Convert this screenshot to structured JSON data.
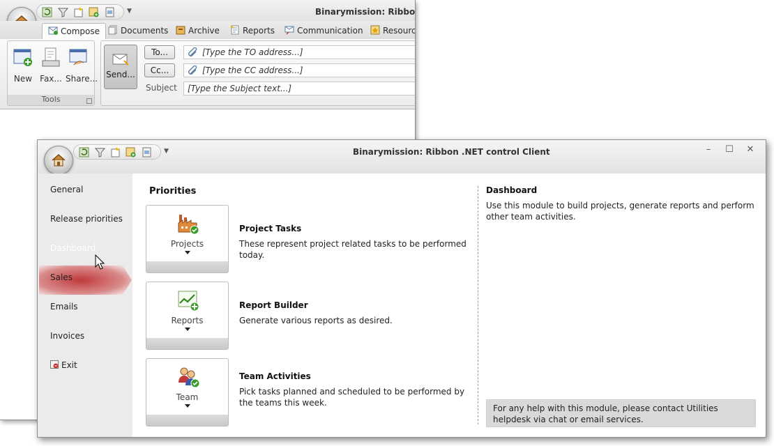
{
  "back_window": {
    "title": "Binarymission: Ribbon .N",
    "tabs": [
      {
        "label": "Compose",
        "icon": "compose-icon"
      },
      {
        "label": "Documents",
        "icon": "documents-icon"
      },
      {
        "label": "Archive",
        "icon": "archive-icon"
      },
      {
        "label": "Reports",
        "icon": "reports-icon"
      },
      {
        "label": "Communication",
        "icon": "communication-icon"
      },
      {
        "label": "Resourc",
        "icon": "resources-icon"
      }
    ],
    "tools_group": {
      "label": "Tools",
      "buttons": [
        {
          "label": "New",
          "icon": "new-window-icon"
        },
        {
          "label": "Fax...",
          "icon": "fax-icon"
        },
        {
          "label": "Share...",
          "icon": "share-icon"
        }
      ]
    },
    "send_label": "Send...",
    "to_button": "To...",
    "cc_button": "Cc...",
    "to_placeholder": "[Type the TO address...]",
    "cc_placeholder": "[Type the CC address...]",
    "subject_label": "Subject",
    "subject_placeholder": "[Type the Subject text...]"
  },
  "front_window": {
    "title": "Binarymission: Ribbon .NET control Client",
    "controls": {
      "minimize": "–",
      "maximize": "☐",
      "close": "✕"
    },
    "nav_items": [
      {
        "label": "General"
      },
      {
        "label": "Release priorities"
      },
      {
        "label": "Dashboard",
        "selected": true
      },
      {
        "label": "Sales"
      },
      {
        "label": "Emails"
      },
      {
        "label": "Invoices"
      },
      {
        "label": "Exit",
        "icon": "exit-icon"
      }
    ],
    "priorities_heading": "Priorities",
    "cards": [
      {
        "button_label": "Projects",
        "icon": "factory-icon",
        "title": "Project Tasks",
        "description": "These represent project related tasks to be performed today."
      },
      {
        "button_label": "Reports",
        "icon": "chart-icon",
        "title": "Report Builder",
        "description": "Generate various reports as desired."
      },
      {
        "button_label": "Team",
        "icon": "team-icon",
        "title": "Team Activities",
        "description": "Pick tasks planned and scheduled to be performed by the teams this week."
      }
    ],
    "detail": {
      "heading": "Dashboard",
      "description": "Use this module to build projects, generate reports and perform other team activities.",
      "help_text": "For any help with this module, please contact Utilities helpdesk via chat or email services."
    }
  },
  "colors": {
    "accent_selected": "#c0393b",
    "nav_bg": "#ebebeb",
    "help_bg": "#d9d9d9"
  }
}
